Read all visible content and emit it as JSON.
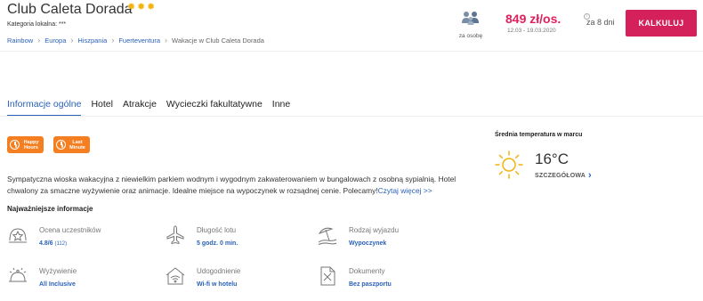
{
  "hotel": {
    "name": "Club Caleta Dorada",
    "stars": 3,
    "local_category": "Kategoria lokalna: ***"
  },
  "breadcrumb": [
    {
      "label": "Rainbow",
      "link": true
    },
    {
      "label": "Europa",
      "link": true
    },
    {
      "label": "Hiszpania",
      "link": true
    },
    {
      "label": "Fuerteventura",
      "link": true
    },
    {
      "label": "Wakacje w Club Caleta Dorada",
      "link": false
    }
  ],
  "booking": {
    "persons_label": "za osobę",
    "price": "849 zł/os.",
    "dates": "12.03 - 19.03.2020",
    "duration": "za 8 dni",
    "calculate_button": "KALKULUJ",
    "info_icon": "i"
  },
  "tabs": [
    {
      "label": "Informacje ogólne",
      "active": true
    },
    {
      "label": "Hotel",
      "active": false
    },
    {
      "label": "Atrakcje",
      "active": false
    },
    {
      "label": "Wycieczki fakultatywne",
      "active": false
    },
    {
      "label": "Inne",
      "active": false
    }
  ],
  "badges": {
    "happy_hours": [
      "Happy",
      "Hours"
    ],
    "last_minute": [
      "Last",
      "Minute"
    ]
  },
  "description": {
    "text": "Sympatyczna wioska wakacyjna z niewielkim parkiem wodnym i wygodnym zakwaterowaniem w bungalowach z osobną sypialnią. Hotel chwalony za smaczne wyżywienie oraz animacje. Idealne miejsce na wypoczynek w rozsądnej cenie. Polecamy!",
    "read_more": "Czytaj więcej >>"
  },
  "key_info": {
    "title": "Najważniejsze informacje",
    "items": [
      {
        "label": "Ocena uczestników",
        "value": "4.8/6",
        "extra": "(112)",
        "icon": "rating-star-icon"
      },
      {
        "label": "Długość lotu",
        "value": "5 godz. 0 min.",
        "extra": "",
        "icon": "airplane-icon"
      },
      {
        "label": "Rodzaj wyjazdu",
        "value": "Wypoczynek",
        "extra": "",
        "icon": "beach-umbrella-icon"
      },
      {
        "label": "Wyżywienie",
        "value": "All Inclusive",
        "extra": "",
        "icon": "food-cloche-icon"
      },
      {
        "label": "Udogodnienie",
        "value": "Wi-fi w hotelu",
        "extra": "",
        "icon": "wifi-house-icon"
      },
      {
        "label": "Dokumenty",
        "value": "Bez paszportu",
        "extra": "",
        "icon": "document-icon"
      }
    ]
  },
  "weather": {
    "title": "Średnia temperatura w marcu",
    "temperature": "16°C",
    "details_link": "SZCZEGÓŁOWA",
    "icon": "sun-icon"
  },
  "colors": {
    "accent": "#2a62b8",
    "price": "#e01f5c",
    "button": "#d4215c",
    "badge": "#f47e20",
    "star": "#f2b20f"
  }
}
